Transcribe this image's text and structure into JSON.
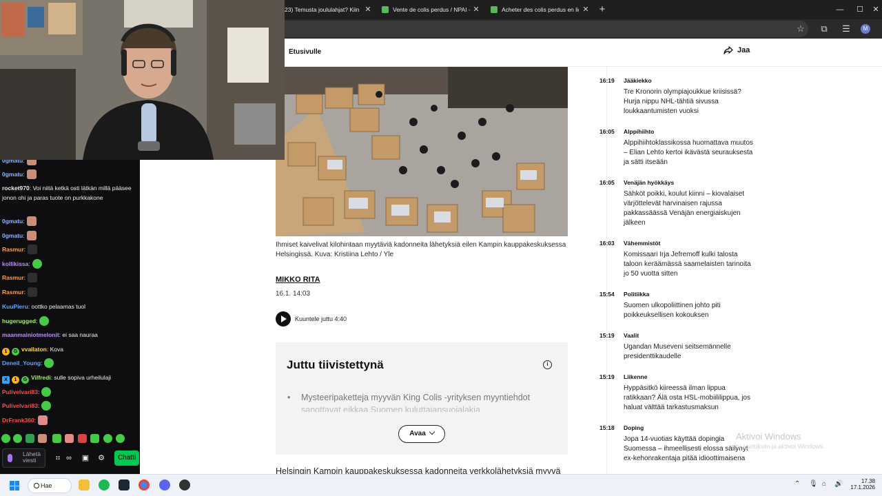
{
  "browser": {
    "tabs": [
      {
        "label": "23) Temusta joululahjat? Kiinan",
        "favicon_color": "#ff4b4b"
      },
      {
        "label": "Vente de colis perdus / NPAI - I",
        "favicon_color": "#5cb85c"
      },
      {
        "label": "Acheter des colis perdus en ligne",
        "favicon_color": "#5cb85c"
      }
    ],
    "new_tab": "+",
    "window_controls": {
      "minimize": "—",
      "maximize": "☐",
      "close": "✕"
    },
    "toolbar_icons": [
      "star-icon",
      "extensions-icon",
      "reading-list-icon",
      "sidebar-icon"
    ],
    "profile_initial": "M"
  },
  "page": {
    "back_link": "Etusivulle",
    "share_label": "Jaa",
    "caption_line1": "Ihmiset kaivelivat kilohintaan myytäviä kadonneita lähetyksiä eilen Kampin kauppakeskuksessa",
    "caption_line2": "Helsingissä. Kuva: Kristiina Lehto / Yle",
    "author": "MIKKO RITA",
    "date": "16.1. 14:03",
    "listen_label": "Kuuntele juttu 4:40",
    "summary": {
      "title": "Juttu tiivistettynä",
      "item": "Mysteeripaketteja myyvän King Colis -yrityksen myyntiehdot",
      "item_cont": "sanottavat eikkaa Suomen kuluttajansuojalakia",
      "open_label": "Avaa"
    },
    "lead": "Helsingin Kampin kauppakeskuksessa kadonneita verkkolähetyksiä myyvä"
  },
  "feed": [
    {
      "time": "16:19",
      "category": "Jääkiekko",
      "title": "Tre Kronorin olympiajoukkue kriisissä? Hurja nippu NHL-tähtiä sivussa loukkaantumisten vuoksi"
    },
    {
      "time": "16:05",
      "category": "Alppihiihto",
      "title": "Alppihiihtoklassikossa huomattava muutos – Elian Lehto kertoi ikävästä seurauksesta ja sätti itseään"
    },
    {
      "time": "16:05",
      "category": "Venäjän hyökkäys",
      "title": "Sähköt poikki, koulut kiinni – kiovalaiset värjöttelevät harvinaisen rajussa pakkassäässä Venäjän energiaiskujen jälkeen"
    },
    {
      "time": "16:03",
      "category": "Vähemmistöt",
      "title": "Komissaari Irja Jefremoff kulki talosta taloon keräämässä saamelaisten tarinoita jo 50 vuotta sitten"
    },
    {
      "time": "15:54",
      "category": "Politiikka",
      "title": "Suomen ulkopoliittinen johto piti poikkeuksellisen kokouksen"
    },
    {
      "time": "15:19",
      "category": "Vaalit",
      "title": "Ugandan Museveni seitsemännelle presidenttikaudelle"
    },
    {
      "time": "15:19",
      "category": "Liikenne",
      "title": "Hyppäsitkö kiireessä ilman lippua ratikkaan? Älä osta HSL-mobiililippua, jos haluat välttää tarkastusmaksun"
    },
    {
      "time": "15:18",
      "category": "Doping",
      "title": "Jopa 14-vuotias käyttää dopingia Suomessa – ihmeellisesti elossa säilynyt ex-kehonrakentaja pitää idioottimaisena"
    }
  ],
  "watermark": {
    "title": "Aktivoi Windows",
    "subtitle": "ty asetuksiin ja aktivoi Windows."
  },
  "chat": {
    "messages": [
      {
        "user": "0gmatu",
        "color": "#8fb4ff",
        "text": "",
        "emote": "#c98f7a",
        "badges": []
      },
      {
        "user": "0gmatu",
        "color": "#8fb4ff",
        "text": "",
        "emote": "#c98f7a",
        "badges": []
      },
      {
        "user": "rocket970",
        "color": "#efeff1",
        "text": "Voi niitä ketkä osti lätkän millä pääsee jonon ohi ja paras tuote on purkkakone",
        "emote": "",
        "badges": []
      },
      {
        "user": "0gmatu",
        "color": "#8fb4ff",
        "text": "",
        "emote": "#c98f7a",
        "badges": []
      },
      {
        "user": "0gmatu",
        "color": "#8fb4ff",
        "text": "",
        "emote": "#c98f7a",
        "badges": []
      },
      {
        "user": "Rasmur",
        "color": "#ff9f43",
        "text": "",
        "emote": "#2f2f2f",
        "badges": []
      },
      {
        "user": "kollikissa",
        "color": "#c08cff",
        "text": "",
        "emote": "#47c947",
        "badges": []
      },
      {
        "user": "Rasmur",
        "color": "#ff9f43",
        "text": "",
        "emote": "#2f2f2f",
        "badges": []
      },
      {
        "user": "Rasmur",
        "color": "#ff9f43",
        "text": "",
        "emote": "#2f2f2f",
        "badges": []
      },
      {
        "user": "KuuPieru",
        "color": "#5aa9ff",
        "text": "oottko pelaamas tuol",
        "emote": "",
        "badges": []
      },
      {
        "user": "hugerugged",
        "color": "#9ff06a",
        "text": "",
        "emote": "#47c947",
        "badges": []
      },
      {
        "user": "maanmainiotmelonit",
        "color": "#c08cff",
        "text": "ei saa nauraa",
        "emote": "",
        "badges": []
      },
      {
        "user": "vvallaton",
        "color": "#ffd84d",
        "text": "Kova",
        "emote": "",
        "badges": [
          "1",
          "G"
        ]
      },
      {
        "user": "Deneil_Young",
        "color": "#5aa9ff",
        "text": "",
        "emote": "#47c947",
        "badges": []
      },
      {
        "user": "Vilfredi",
        "color": "#9ff06a",
        "text": "sulle sopiva urheilulaji",
        "emote": "",
        "badges": [
          "X",
          "1",
          "G"
        ]
      },
      {
        "user": "Pulivelvari83",
        "color": "#ff4d4d",
        "text": "",
        "emote": "#47c947",
        "badges": []
      },
      {
        "user": "Pulivelvari83",
        "color": "#ff4d4d",
        "text": "",
        "emote": "#47c947",
        "badges": []
      },
      {
        "user": "DrFrank360",
        "color": "#ff4d4d",
        "text": "",
        "emote": "#e08a8a",
        "badges": []
      }
    ],
    "input_placeholder": "Lähetä viesti",
    "send_button": "Chatti"
  },
  "taskbar": {
    "search_label": "Hae",
    "time": "17.38",
    "date": "17.1.2026"
  }
}
